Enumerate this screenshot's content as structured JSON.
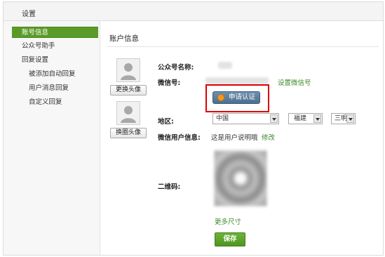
{
  "header": {
    "title": "设置"
  },
  "sidebar": {
    "items": [
      {
        "label": "账号信息",
        "active": true
      },
      {
        "label": "公众号助手"
      },
      {
        "label": "回复设置"
      },
      {
        "label": "被添加自动回复",
        "sub": true
      },
      {
        "label": "用户消息回复",
        "sub": true
      },
      {
        "label": "自定义回复",
        "sub": true
      }
    ]
  },
  "main": {
    "section_title": "账户信息",
    "avatar_buttons": {
      "change_avatar": "更换头像",
      "change_image_avatar": "换圈头像"
    },
    "fields": {
      "public_name_label": "公众号名称:",
      "wechat_id_label": "微信号:",
      "set_wechat_id_link": "设置微信号",
      "auth_button": "申请认证",
      "region_label": "地区:",
      "country": "中国",
      "province": "福建",
      "city": "三明",
      "user_info_label": "微信用户信息:",
      "user_info_value": "这是用户说明哦",
      "edit_link": "修改",
      "qr_label": "二维码:",
      "more_sizes_link": "更多尺寸",
      "save_button": "保存"
    }
  },
  "colors": {
    "accent_green": "#5a9b27",
    "highlight_red": "#e00000",
    "auth_blue": "#5b7c9d"
  }
}
